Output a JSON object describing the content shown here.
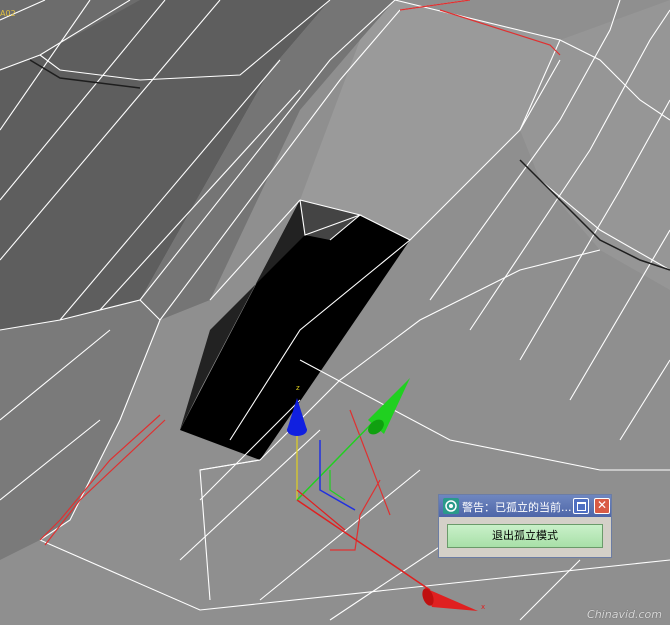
{
  "viewport": {
    "object_label": "A02",
    "gizmo_axes": {
      "z": "z",
      "x": "x"
    }
  },
  "dialog": {
    "title": "警告：已孤立的当前...",
    "icon": "app-icon",
    "restore_icon": "restore-icon",
    "close_icon": "close-icon",
    "close_glyph": "✕",
    "exit_button_label": "退出孤立模式"
  },
  "watermark": "Chinavid.com",
  "colors": {
    "viewport_bg": "#8e8e8e",
    "wire": "#ffffff",
    "selection_edge": "#e03030",
    "gizmo_x": "#e02020",
    "gizmo_y": "#20d020",
    "gizmo_z": "#2030e0",
    "dialog_title": "#5a72b4",
    "exit_button": "#b8e8b8"
  }
}
